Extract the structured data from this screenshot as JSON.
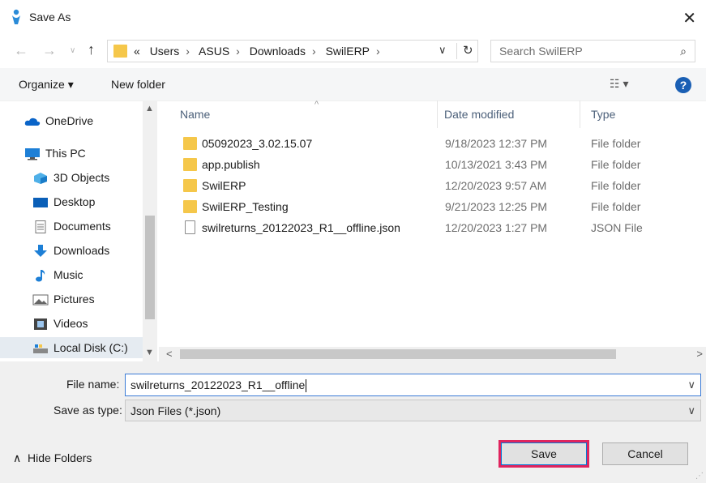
{
  "window": {
    "title": "Save As"
  },
  "nav": {
    "crumbs": [
      "«",
      "Users",
      "ASUS",
      "Downloads",
      "SwilERP"
    ],
    "search_placeholder": "Search SwilERP"
  },
  "toolbar": {
    "organize": "Organize ▾",
    "new_folder": "New folder"
  },
  "sidebar": {
    "items": [
      {
        "label": "OneDrive",
        "icon": "cloud-icon"
      },
      {
        "label": "This PC",
        "icon": "monitor-icon"
      },
      {
        "label": "3D Objects",
        "icon": "cube-icon"
      },
      {
        "label": "Desktop",
        "icon": "desktop-icon"
      },
      {
        "label": "Documents",
        "icon": "document-icon"
      },
      {
        "label": "Downloads",
        "icon": "download-icon"
      },
      {
        "label": "Music",
        "icon": "music-icon"
      },
      {
        "label": "Pictures",
        "icon": "picture-icon"
      },
      {
        "label": "Videos",
        "icon": "film-icon"
      },
      {
        "label": "Local Disk (C:)",
        "icon": "disk-icon"
      }
    ]
  },
  "columns": {
    "name": "Name",
    "date": "Date modified",
    "type": "Type"
  },
  "files": [
    {
      "name": "05092023_3.02.15.07",
      "date": "9/18/2023 12:37 PM",
      "type": "File folder"
    },
    {
      "name": "app.publish",
      "date": "10/13/2021 3:43 PM",
      "type": "File folder"
    },
    {
      "name": "SwilERP",
      "date": "12/20/2023 9:57 AM",
      "type": "File folder"
    },
    {
      "name": "SwilERP_Testing",
      "date": "9/21/2023 12:25 PM",
      "type": "File folder"
    },
    {
      "name": "swilreturns_20122023_R1__offline.json",
      "date": "12/20/2023 1:27 PM",
      "type": "JSON File"
    }
  ],
  "form": {
    "file_name_label": "File name:",
    "file_name_value": "swilreturns_20122023_R1__offline",
    "save_type_label": "Save as type:",
    "save_type_value": "Json Files (*.json)"
  },
  "footer": {
    "hide_folders": "Hide Folders",
    "save": "Save",
    "cancel": "Cancel"
  },
  "colors": {
    "accent": "#0078d7",
    "highlight": "#e0245e",
    "folder": "#f5c74a"
  }
}
